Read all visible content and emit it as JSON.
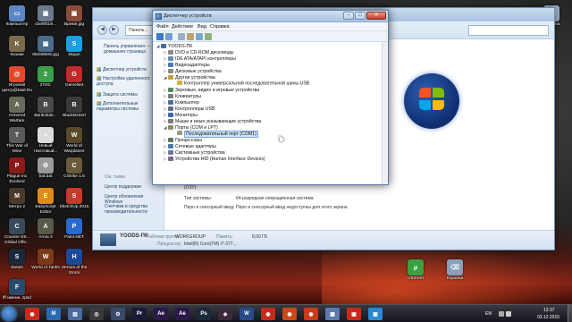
{
  "desktop": {
    "icons": [
      {
        "label": "Компьютер",
        "color": "#5b87c4",
        "glyph": "▭"
      },
      {
        "label": "cbe9f019...",
        "color": "#6a7a8a",
        "glyph": "▣"
      },
      {
        "label": "Время.jpg",
        "color": "#8a4a3a",
        "glyph": "▣"
      },
      {
        "label": "Казаки",
        "color": "#7a6a4a",
        "glyph": "K"
      },
      {
        "label": "8526958S.jpg",
        "color": "#4a6a8a",
        "glyph": "▣"
      },
      {
        "label": "Skype",
        "color": "#1aa0e0",
        "glyph": "S"
      },
      {
        "label": "Игровой центр@Mail.Ru",
        "color": "#e04a2a",
        "glyph": "@"
      },
      {
        "label": "2ГИС",
        "color": "#3aa04a",
        "glyph": "2"
      },
      {
        "label": "GameNet",
        "color": "#c02a2a",
        "glyph": "G"
      },
      {
        "label": "Armored Warfare",
        "color": "#6a6a5a",
        "glyph": "A"
      },
      {
        "label": "Bankobok...",
        "color": "#4a4a4a",
        "glyph": "B"
      },
      {
        "label": "BlackDesert",
        "color": "#3a3a3a",
        "glyph": "B"
      },
      {
        "label": "This War of Mine",
        "color": "#5a5a5a",
        "glyph": "T"
      },
      {
        "label": "Новый текстовый...",
        "color": "#dcdcdc",
        "glyph": "≡"
      },
      {
        "label": "World of Warplanes",
        "color": "#5a4a2a",
        "glyph": "W"
      },
      {
        "label": "Plague Inc Evolved",
        "color": "#8a1a1a",
        "glyph": "P"
      },
      {
        "label": "bat.bat",
        "color": "#9a9a9a",
        "glyph": "⚙"
      },
      {
        "label": "CStrike 1.6",
        "color": "#6a5a3a",
        "glyph": "C"
      },
      {
        "label": "Метро 2",
        "color": "#4a3a2a",
        "glyph": "M"
      },
      {
        "label": "EasyScript Editor",
        "color": "#e08a1a",
        "glyph": "E"
      },
      {
        "label": "SketchUp 2015",
        "color": "#c83a2a",
        "glyph": "S"
      },
      {
        "label": "Counter-Str... Global Offe...",
        "color": "#3a4a5a",
        "glyph": "C"
      },
      {
        "label": "Arma 3",
        "color": "#5a5a4a",
        "glyph": "A"
      },
      {
        "label": "Paint.NET",
        "color": "#2a6ad0",
        "glyph": "P"
      },
      {
        "label": "Steam",
        "color": "#1a2a3a",
        "glyph": "S"
      },
      {
        "label": "World of Tanks",
        "color": "#7a3a1a",
        "glyph": "W"
      },
      {
        "label": "Heroes of the Storm",
        "color": "#1a4a9a",
        "glyph": "H"
      },
      {
        "label": "fff имени..zpsd",
        "color": "#2a4a6a",
        "glyph": "F"
      }
    ],
    "right_icons": [
      {
        "label": "Корзина",
        "color": "#9ab0c8",
        "glyph": "⌫"
      },
      {
        "label": "uTorrent",
        "color": "#3aa040",
        "glyph": "μ"
      },
      {
        "label": "Корзина",
        "color": "#8aa0b8",
        "glyph": "⌫"
      }
    ]
  },
  "explorer": {
    "address": "Панель...",
    "search_placeholder": "",
    "nav": {
      "home_link": "Панель управления — домашняя страница",
      "items": [
        "Диспетчер устройств",
        "Настройка удаленного доступа",
        "Защита системы",
        "Дополнительные параметры системы"
      ],
      "see_also": "См. также",
      "links": [
        "Центр поддержки",
        "Центр обновления Windows",
        "Счетчики и средства производительности"
      ]
    },
    "system": {
      "rows": [
        {
          "key": "(ОЗУ):",
          "value": ""
        },
        {
          "key": "Тип системы:",
          "value": "64-разрядная операционная система"
        },
        {
          "key": "Перо и сенсорный ввод:",
          "value": "Перо и сенсорный ввод недоступны для этого экрана"
        }
      ]
    },
    "status": {
      "computer_name": "YOODS-ПК",
      "workgroup_label": "Рабочая группа:",
      "workgroup": "WORKGROUP",
      "memory_label": "Память:",
      "memory": "8,00 ГБ",
      "cpu_label": "Процессор:",
      "cpu": "Intel(R) Core(TM) i7-377..."
    }
  },
  "device_manager": {
    "title": "Диспетчер устройств",
    "menu": [
      "Файл",
      "Действие",
      "Вид",
      "Справка"
    ],
    "root": "YOODS-ПК",
    "nodes": [
      {
        "label": "DVD и CD-ROM дисководы",
        "color": "#8a8a8a",
        "expander": "▷"
      },
      {
        "label": "IDE ATA/ATAPI контроллеры",
        "color": "#6a8ab0",
        "expander": "▷"
      },
      {
        "label": "Видеоадаптеры",
        "color": "#4a7ab0",
        "expander": "▷"
      },
      {
        "label": "Дисковые устройства",
        "color": "#8a8a8a",
        "expander": "▷"
      },
      {
        "label": "Другие устройства",
        "color": "#c0a040",
        "expander": "◢"
      },
      {
        "label": "Контроллер универсальной последовательной шины USB",
        "color": "#d0b040",
        "expander": "",
        "indent": 1
      },
      {
        "label": "Звуковые, видео и игровые устройства",
        "color": "#5a8a5a",
        "expander": "▷"
      },
      {
        "label": "Клавиатуры",
        "color": "#7a7a7a",
        "expander": "▷"
      },
      {
        "label": "Компьютер",
        "color": "#4a6a9a",
        "expander": "▷"
      },
      {
        "label": "Контроллеры USB",
        "color": "#6a6a8a",
        "expander": "▷"
      },
      {
        "label": "Мониторы",
        "color": "#3a6aaa",
        "expander": "▷"
      },
      {
        "label": "Мыши и иные указывающие устройства",
        "color": "#7a7a7a",
        "expander": "▷"
      },
      {
        "label": "Порты (COM и LPT)",
        "color": "#8a8a6a",
        "expander": "◢"
      },
      {
        "label": "Последовательный порт (COM1)",
        "color": "#9a9a7a",
        "expander": "",
        "indent": 1,
        "selected": true
      },
      {
        "label": "Процессоры",
        "color": "#5a7a5a",
        "expander": "▷"
      },
      {
        "label": "Сетевые адаптеры",
        "color": "#4a7aaa",
        "expander": "▷"
      },
      {
        "label": "Системные устройства",
        "color": "#6a7a9a",
        "expander": "▷"
      },
      {
        "label": "Устройства HID (Human Interface Devices)",
        "color": "#7a6a8a",
        "expander": "▷"
      }
    ]
  },
  "taskbar": {
    "apps": [
      {
        "color": "#c82a1a",
        "glyph": "◉"
      },
      {
        "color": "#2a6ab0",
        "glyph": "M"
      },
      {
        "color": "#4a6aa0",
        "glyph": "▤"
      },
      {
        "color": "#3a3a3a",
        "glyph": "◎"
      },
      {
        "color": "#3a4a6a",
        "glyph": "⚙"
      },
      {
        "color": "#1a1a3a",
        "glyph": "Pr"
      },
      {
        "color": "#2a1a4a",
        "glyph": "Ae"
      },
      {
        "color": "#2a1a4a",
        "glyph": "Ae"
      },
      {
        "color": "#1a2a3a",
        "glyph": "Ps"
      },
      {
        "color": "#3a2a3a",
        "glyph": "◈"
      },
      {
        "color": "#2a4a8a",
        "glyph": "W"
      },
      {
        "color": "#c82a1a",
        "glyph": "◉"
      },
      {
        "color": "#c84a1a",
        "glyph": "◉"
      },
      {
        "color": "#c83a1a",
        "glyph": "◉"
      },
      {
        "color": "#5a7ab0",
        "glyph": "▦"
      },
      {
        "color": "#c82a1a",
        "glyph": "▣"
      },
      {
        "color": "#2a8ad0",
        "glyph": "▣"
      }
    ],
    "lang": "EN",
    "time": "12:37",
    "date": "03.12.2015"
  }
}
